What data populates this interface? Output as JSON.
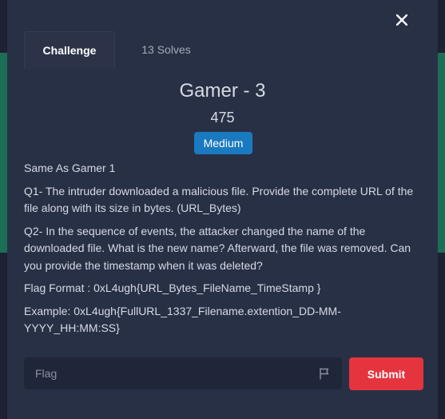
{
  "modal": {
    "close_label": "×"
  },
  "tabs": [
    {
      "label": "Challenge",
      "active": true
    },
    {
      "label": "13 Solves",
      "active": false
    }
  ],
  "challenge": {
    "title": "Gamer - 3",
    "points": "475",
    "difficulty": "Medium",
    "difficulty_color": "#1a7ac0",
    "description": [
      "Same As Gamer 1",
      "Q1- The intruder downloaded a malicious file. Provide the complete URL of the file along with its size in bytes. (URL_Bytes)",
      "Q2- In the sequence of events, the attacker changed the name of the downloaded file. What is the new name? Afterward, the file was removed. Can you provide the timestamp when it was deleted?",
      "Flag Format : 0xL4ugh{URL_Bytes_FileName_TimeStamp }",
      "Example: 0xL4ugh{FullURL_1337_Filename.extention_DD-MM-YYYY_HH:MM:SS}"
    ]
  },
  "form": {
    "flag_placeholder": "Flag",
    "flag_value": "",
    "flag_icon": "flag-icon",
    "submit_label": "Submit",
    "submit_color": "#e5343e"
  }
}
